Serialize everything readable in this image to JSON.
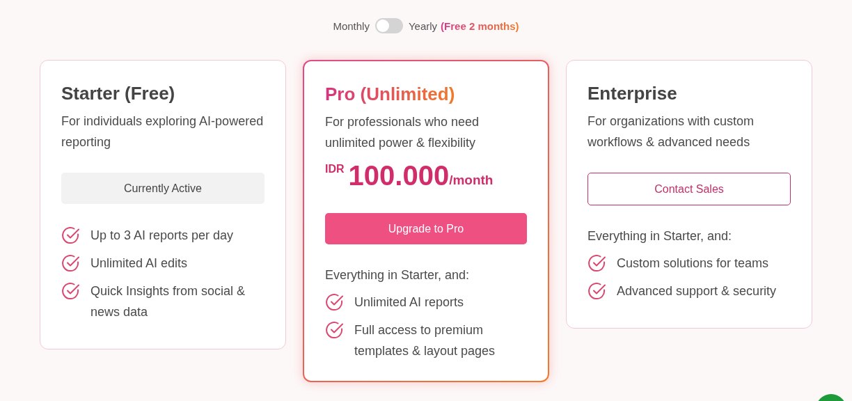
{
  "billing_toggle": {
    "monthly_label": "Monthly",
    "yearly_label": "Yearly",
    "yearly_note": "(Free 2 months)",
    "yearly": false
  },
  "plans": [
    {
      "name": "Starter (Free)",
      "featured": false,
      "description": "For individuals exploring AI-powered reporting",
      "button": {
        "kind": "current",
        "label": "Currently Active"
      },
      "features": [
        "Up to 3 AI reports per day",
        "Unlimited AI edits",
        "Quick Insights from social & news data"
      ]
    },
    {
      "name": "Pro (Unlimited)",
      "featured": true,
      "description": "For professionals who need unlimited power & flexibility",
      "price": {
        "currency": "IDR",
        "amount": "100.000",
        "period": "/month"
      },
      "button": {
        "kind": "upgrade",
        "label": "Upgrade to Pro"
      },
      "intro": "Everything in Starter, and:",
      "features": [
        "Unlimited AI reports",
        "Full access to premium templates & layout pages"
      ]
    },
    {
      "name": "Enterprise",
      "featured": false,
      "description": "For organizations with custom workflows & advanced needs",
      "button": {
        "kind": "contact",
        "label": "Contact Sales"
      },
      "intro": "Everything in Starter, and:",
      "features": [
        "Custom solutions for teams",
        "Advanced support & security"
      ]
    }
  ]
}
